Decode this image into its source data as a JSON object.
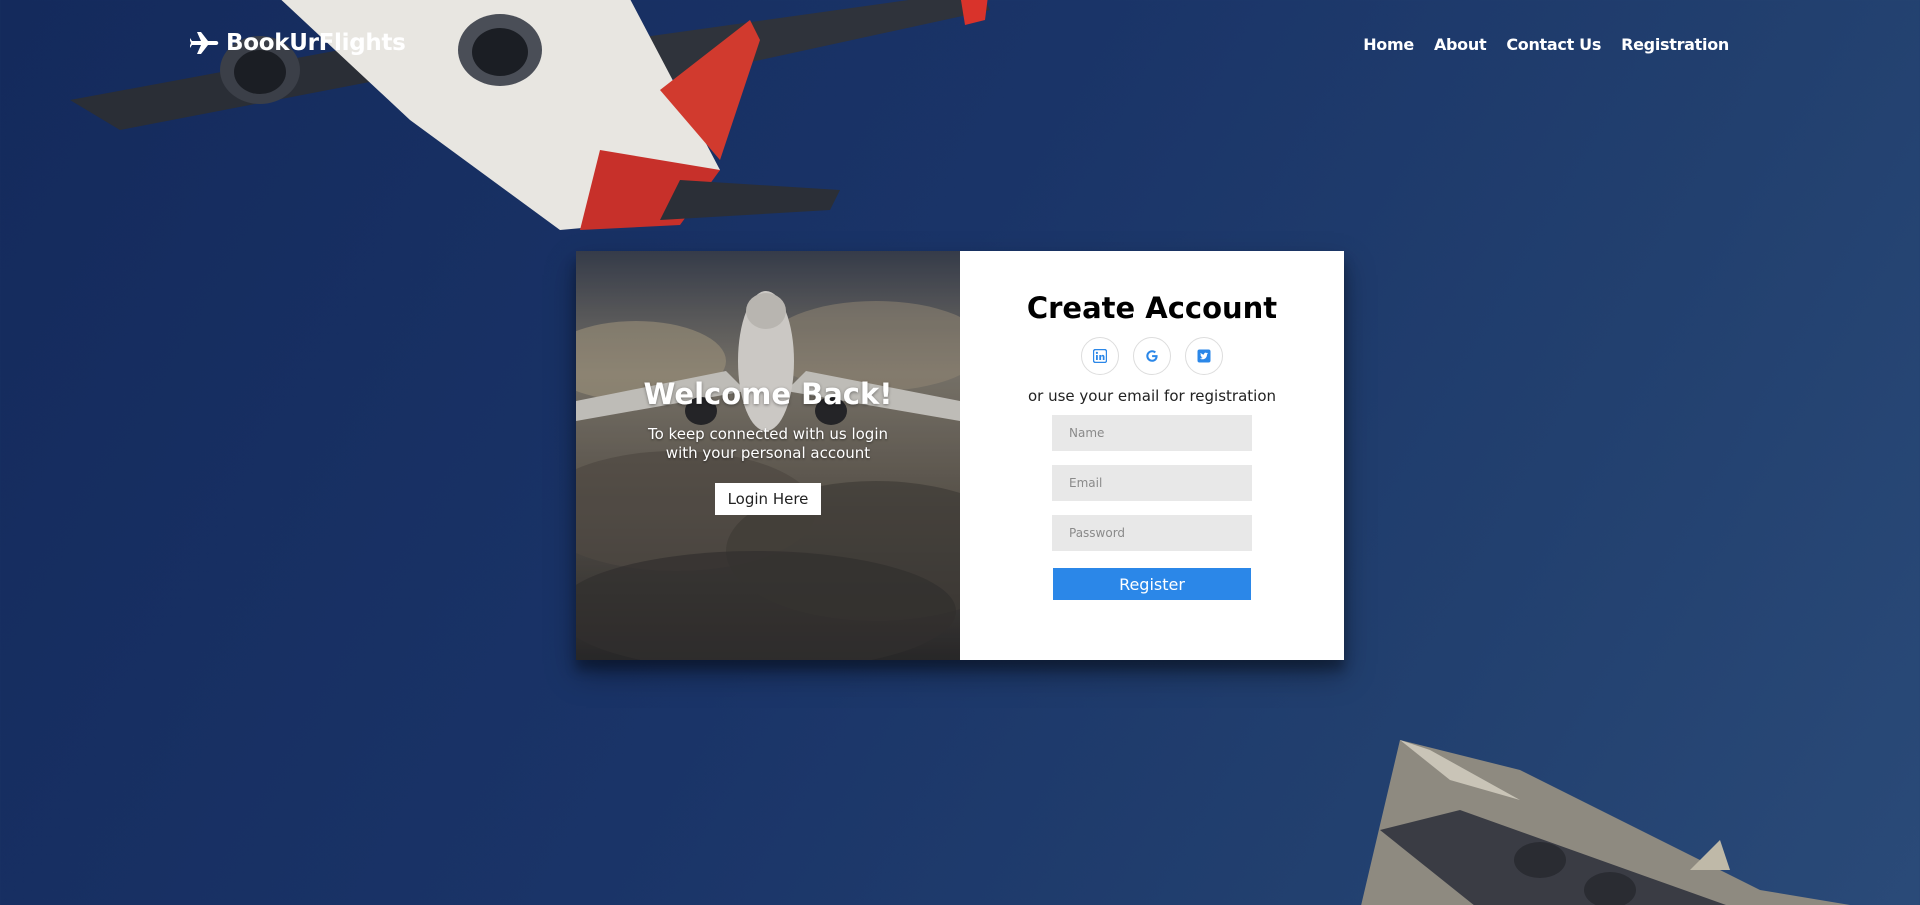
{
  "brand": {
    "name": "BookUrFlights",
    "icon": "airplane-icon"
  },
  "nav": {
    "items": [
      {
        "label": "Home"
      },
      {
        "label": "About"
      },
      {
        "label": "Contact Us"
      },
      {
        "label": "Registration"
      }
    ]
  },
  "welcome": {
    "title": "Welcome Back!",
    "text": "To keep connected with us login with your personal account",
    "login_label": "Login Here"
  },
  "register": {
    "title": "Create Account",
    "socials": [
      {
        "icon": "linkedin-icon"
      },
      {
        "icon": "google-icon"
      },
      {
        "icon": "twitter-icon"
      }
    ],
    "hint": "or use your email for registration",
    "fields": {
      "name_placeholder": "Name",
      "email_placeholder": "Email",
      "password_placeholder": "Password"
    },
    "submit_label": "Register"
  },
  "colors": {
    "background": "#1a3468",
    "accent": "#2b87e8",
    "input_bg": "#e8e8e8"
  }
}
